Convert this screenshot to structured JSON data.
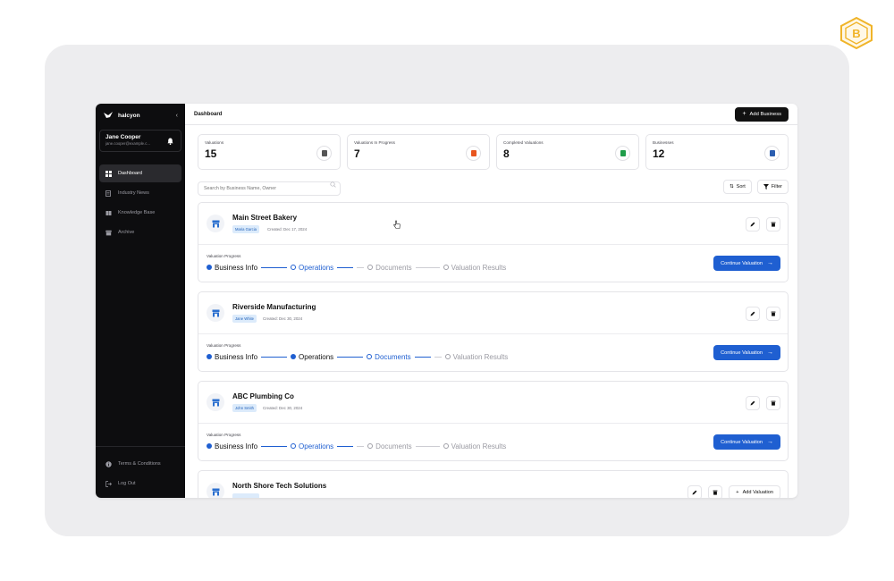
{
  "sidebar": {
    "app_name": "halcyon",
    "collapse_icon": "chevron-left-icon",
    "user": {
      "name": "Jane Cooper",
      "email": "jane.cooper@example.c..."
    },
    "items": [
      {
        "label": "Dashboard",
        "icon": "grid-icon",
        "active": true
      },
      {
        "label": "Industry News",
        "icon": "news-icon",
        "active": false
      },
      {
        "label": "Knowledge Base",
        "icon": "book-icon",
        "active": false
      },
      {
        "label": "Archive",
        "icon": "archive-icon",
        "active": false
      }
    ],
    "bottom_items": [
      {
        "label": "Terms & Conditions",
        "icon": "info-icon"
      },
      {
        "label": "Log Out",
        "icon": "logout-icon"
      }
    ]
  },
  "header": {
    "title": "Dashboard",
    "add_business_label": "Add Business"
  },
  "stats": [
    {
      "label": "Valuations",
      "value": "15",
      "icon": "document-icon",
      "color": "#555555"
    },
    {
      "label": "Valuations In Progress",
      "value": "7",
      "icon": "document-icon",
      "color": "#e8551e"
    },
    {
      "label": "Completed Valuations",
      "value": "8",
      "icon": "document-icon",
      "color": "#1f9d4a"
    },
    {
      "label": "Businesses",
      "value": "12",
      "icon": "store-icon",
      "color": "#2a5db0"
    }
  ],
  "toolbar": {
    "search_placeholder": "Search by Business Name, Owner",
    "sort_label": "Sort",
    "filter_label": "Filter"
  },
  "businesses": [
    {
      "name": "Main Street Bakery",
      "owner": "Maria Garcia",
      "created": "Created: Dec 17, 2024",
      "progress_label": "Valuation Progress",
      "steps": [
        "Business Info",
        "Operations",
        "Documents",
        "Valuation Results"
      ],
      "steps_done": 1,
      "continue_label": "Continue Valuation"
    },
    {
      "name": "Riverside Manufacturing",
      "owner": "Jane White",
      "created": "Created: Dec 30, 2024",
      "progress_label": "Valuation Progress",
      "steps": [
        "Business Info",
        "Operations",
        "Documents",
        "Valuation Results"
      ],
      "steps_done": 2,
      "continue_label": "Continue Valuation"
    },
    {
      "name": "ABC Plumbing Co",
      "owner": "John Smith",
      "created": "Created: Dec 30, 2024",
      "progress_label": "Valuation Progress",
      "steps": [
        "Business Info",
        "Operations",
        "Documents",
        "Valuation Results"
      ],
      "steps_done": 1,
      "continue_label": "Continue Valuation"
    },
    {
      "name": "North Shore Tech Solutions",
      "add_valuation_label": "Add Valuation"
    }
  ],
  "colors": {
    "accent": "#1f5fd1",
    "sidebar_bg": "#0d0d0f",
    "frame_bg": "#ededef",
    "badge": "#f0b429"
  }
}
